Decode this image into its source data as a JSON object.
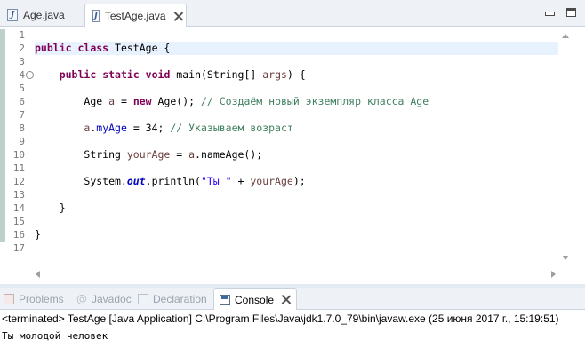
{
  "editor_tabs": [
    {
      "label": "Age.java",
      "icon": "java-file-icon",
      "active": false
    },
    {
      "label": "TestAge.java",
      "icon": "java-file-icon",
      "active": true
    }
  ],
  "line_numbers": [
    "1",
    "2",
    "3",
    "4",
    "5",
    "6",
    "7",
    "8",
    "9",
    "10",
    "11",
    "12",
    "13",
    "14",
    "15",
    "16",
    "17"
  ],
  "code": {
    "l2": {
      "kw1": "public",
      "kw2": "class",
      "rest": " TestAge {"
    },
    "l4": {
      "kw1": "public",
      "kw2": "static",
      "kw3": "void",
      "mid": " main(String[] ",
      "param": "args",
      "end": ") {"
    },
    "l6": {
      "pre": "Age ",
      "var": "a",
      "eq": " = ",
      "kw": "new",
      "call": " Age(); ",
      "comment": "// Создаём новый экземпляр класса Age"
    },
    "l8": {
      "var": "a",
      "dot": ".",
      "field": "myAge",
      "assign": " = 34; ",
      "comment": "// Указываем возраст"
    },
    "l10": {
      "pre": "String ",
      "var": "yourAge",
      "eq": " = ",
      "var2": "a",
      "call": ".nameAge();"
    },
    "l12": {
      "pre": "System.",
      "field": "out",
      "mid": ".println(",
      "str": "\"Ты \"",
      "plus": " + ",
      "var": "yourAge",
      "end": ");"
    },
    "l14": {
      "text": "}"
    },
    "l16": {
      "text": "}"
    }
  },
  "panel_tabs": [
    {
      "label": "Problems",
      "icon": "problems-icon",
      "active": false
    },
    {
      "label": "Javadoc",
      "icon": "javadoc-icon",
      "active": false
    },
    {
      "label": "Declaration",
      "icon": "declaration-icon",
      "active": false
    },
    {
      "label": "Console",
      "icon": "console-icon",
      "active": true
    }
  ],
  "console": {
    "status": "<terminated> TestAge [Java Application] C:\\Program Files\\Java\\jdk1.7.0_79\\bin\\javaw.exe (25 июня 2017 г., 15:19:51)",
    "output": "Ты молодой человек"
  }
}
